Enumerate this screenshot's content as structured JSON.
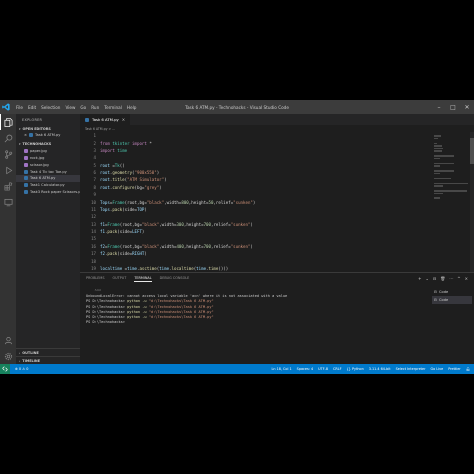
{
  "window": {
    "title": "Task 6 ATM.py - Technohacks - Visual Studio Code",
    "menu": [
      "File",
      "Edit",
      "Selection",
      "View",
      "Go",
      "Run",
      "Terminal",
      "Help"
    ]
  },
  "sidebar": {
    "title": "EXPLORER",
    "open_editors": {
      "label": "OPEN EDITORS",
      "items": [
        {
          "label": "Task 6 ATM.py",
          "close": "×"
        }
      ]
    },
    "workspace": {
      "label": "TECHNOHACKS",
      "files": [
        {
          "name": "paper.jpg",
          "color": "#a074c4"
        },
        {
          "name": "rock.jpg",
          "color": "#a074c4"
        },
        {
          "name": "scissor.jpg",
          "color": "#a074c4"
        },
        {
          "name": "Task 4 Tic tac Toe.py",
          "color": "#3572a5"
        },
        {
          "name": "Task 6 ATM.py",
          "color": "#3572a5"
        },
        {
          "name": "Task1 Calculator.py",
          "color": "#3572a5"
        },
        {
          "name": "Task3 Rock paper Scissors.py",
          "color": "#3572a5"
        }
      ]
    },
    "bottom_sections": [
      "OUTLINE",
      "TIMELINE"
    ]
  },
  "editor": {
    "tab_label": "Task 6 ATM.py",
    "tab_close": "×",
    "breadcrumb": "Task 6 ATM.py > ...",
    "lines": [
      {
        "n": "1",
        "tokens": []
      },
      {
        "n": "2",
        "tokens": [
          {
            "c": "kw",
            "t": "from "
          },
          {
            "c": "cl",
            "t": "tkinter "
          },
          {
            "c": "kw",
            "t": "import "
          },
          {
            "c": "pl",
            "t": "*"
          }
        ]
      },
      {
        "n": "3",
        "tokens": [
          {
            "c": "kw",
            "t": "import "
          },
          {
            "c": "cl",
            "t": "time"
          }
        ]
      },
      {
        "n": "4",
        "tokens": []
      },
      {
        "n": "5",
        "tokens": [
          {
            "c": "vr",
            "t": "root"
          },
          {
            "c": "pl",
            "t": " ="
          },
          {
            "c": "cl",
            "t": "Tk"
          },
          {
            "c": "pl",
            "t": "()"
          }
        ]
      },
      {
        "n": "6",
        "tokens": [
          {
            "c": "vr",
            "t": "root"
          },
          {
            "c": "pl",
            "t": "."
          },
          {
            "c": "fn",
            "t": "geometry"
          },
          {
            "c": "pl",
            "t": "("
          },
          {
            "c": "st",
            "t": "\"900x550\""
          },
          {
            "c": "pl",
            "t": ")"
          }
        ]
      },
      {
        "n": "7",
        "tokens": [
          {
            "c": "vr",
            "t": "root"
          },
          {
            "c": "pl",
            "t": "."
          },
          {
            "c": "fn",
            "t": "title"
          },
          {
            "c": "pl",
            "t": "("
          },
          {
            "c": "st",
            "t": "\"ATM Simulator\""
          },
          {
            "c": "pl",
            "t": ")"
          }
        ]
      },
      {
        "n": "8",
        "tokens": [
          {
            "c": "vr",
            "t": "root"
          },
          {
            "c": "pl",
            "t": "."
          },
          {
            "c": "fn",
            "t": "configure"
          },
          {
            "c": "pl",
            "t": "(bg="
          },
          {
            "c": "st",
            "t": "\"grey\""
          },
          {
            "c": "pl",
            "t": ")"
          }
        ]
      },
      {
        "n": "9",
        "tokens": []
      },
      {
        "n": "10",
        "tokens": [
          {
            "c": "vr",
            "t": "Tops"
          },
          {
            "c": "pl",
            "t": "="
          },
          {
            "c": "cl",
            "t": "Frame"
          },
          {
            "c": "pl",
            "t": "(root,bg="
          },
          {
            "c": "st",
            "t": "\"black\""
          },
          {
            "c": "pl",
            "t": ",width="
          },
          {
            "c": "nm",
            "t": "800"
          },
          {
            "c": "pl",
            "t": ",height="
          },
          {
            "c": "nm",
            "t": "50"
          },
          {
            "c": "pl",
            "t": ",relief="
          },
          {
            "c": "st",
            "t": "\"sunken\""
          },
          {
            "c": "pl",
            "t": ")"
          }
        ]
      },
      {
        "n": "11",
        "tokens": [
          {
            "c": "vr",
            "t": "Tops"
          },
          {
            "c": "pl",
            "t": "."
          },
          {
            "c": "fn",
            "t": "pack"
          },
          {
            "c": "pl",
            "t": "(side="
          },
          {
            "c": "vr",
            "t": "TOP"
          },
          {
            "c": "pl",
            "t": ")"
          }
        ]
      },
      {
        "n": "12",
        "tokens": []
      },
      {
        "n": "13",
        "tokens": [
          {
            "c": "vr",
            "t": "f1"
          },
          {
            "c": "pl",
            "t": "="
          },
          {
            "c": "cl",
            "t": "Frame"
          },
          {
            "c": "pl",
            "t": "(root,bg="
          },
          {
            "c": "st",
            "t": "\"black\""
          },
          {
            "c": "pl",
            "t": ",width="
          },
          {
            "c": "nm",
            "t": "300"
          },
          {
            "c": "pl",
            "t": ",height="
          },
          {
            "c": "nm",
            "t": "700"
          },
          {
            "c": "pl",
            "t": ",relief="
          },
          {
            "c": "st",
            "t": "\"sunken\""
          },
          {
            "c": "pl",
            "t": ")"
          }
        ]
      },
      {
        "n": "14",
        "tokens": [
          {
            "c": "vr",
            "t": "f1"
          },
          {
            "c": "pl",
            "t": "."
          },
          {
            "c": "fn",
            "t": "pack"
          },
          {
            "c": "pl",
            "t": "(side="
          },
          {
            "c": "vr",
            "t": "LEFT"
          },
          {
            "c": "pl",
            "t": ")"
          }
        ]
      },
      {
        "n": "15",
        "tokens": []
      },
      {
        "n": "16",
        "tokens": [
          {
            "c": "vr",
            "t": "f2"
          },
          {
            "c": "pl",
            "t": "="
          },
          {
            "c": "cl",
            "t": "Frame"
          },
          {
            "c": "pl",
            "t": "(root,bg="
          },
          {
            "c": "st",
            "t": "\"black\""
          },
          {
            "c": "pl",
            "t": ",width="
          },
          {
            "c": "nm",
            "t": "400"
          },
          {
            "c": "pl",
            "t": ",height="
          },
          {
            "c": "nm",
            "t": "700"
          },
          {
            "c": "pl",
            "t": ",relief="
          },
          {
            "c": "st",
            "t": "\"sunken\""
          },
          {
            "c": "pl",
            "t": ")"
          }
        ]
      },
      {
        "n": "17",
        "tokens": [
          {
            "c": "vr",
            "t": "f2"
          },
          {
            "c": "pl",
            "t": "."
          },
          {
            "c": "fn",
            "t": "pack"
          },
          {
            "c": "pl",
            "t": "(side="
          },
          {
            "c": "vr",
            "t": "RIGHT"
          },
          {
            "c": "pl",
            "t": ")"
          }
        ]
      },
      {
        "n": "18",
        "tokens": []
      },
      {
        "n": "19",
        "tokens": [
          {
            "c": "vr",
            "t": "localtime"
          },
          {
            "c": "pl",
            "t": " ="
          },
          {
            "c": "vr",
            "t": "time"
          },
          {
            "c": "pl",
            "t": "."
          },
          {
            "c": "fn",
            "t": "asctime"
          },
          {
            "c": "pl",
            "t": "("
          },
          {
            "c": "vr",
            "t": "time"
          },
          {
            "c": "pl",
            "t": "."
          },
          {
            "c": "fn",
            "t": "localtime"
          },
          {
            "c": "pl",
            "t": "("
          },
          {
            "c": "vr",
            "t": "time"
          },
          {
            "c": "pl",
            "t": "."
          },
          {
            "c": "fn",
            "t": "time"
          },
          {
            "c": "pl",
            "t": "()))"
          }
        ]
      },
      {
        "n": "20",
        "tokens": []
      },
      {
        "n": "21",
        "tokens": [
          {
            "c": "vr",
            "t": "label1"
          },
          {
            "c": "pl",
            "t": " ="
          },
          {
            "c": "cl",
            "t": "Label"
          },
          {
            "c": "pl",
            "t": "(Tops,font=("
          },
          {
            "c": "st",
            "t": "\"Times New Roman\""
          },
          {
            "c": "pl",
            "t": ","
          },
          {
            "c": "nm",
            "t": "26"
          },
          {
            "c": "pl",
            "t": ","
          },
          {
            "c": "st",
            "t": "'bold'"
          },
          {
            "c": "pl",
            "t": ") ,text="
          },
          {
            "c": "st",
            "t": "\"ATM Simulator\""
          },
          {
            "c": "pl",
            "t": ", fg="
          },
          {
            "c": "st",
            "t": "\"powder blue\""
          },
          {
            "c": "pl",
            "t": ",bg="
          },
          {
            "c": "st",
            "t": "\"grey\""
          },
          {
            "c": "pl",
            "t": ",bd="
          },
          {
            "c": "nm",
            "t": "10"
          },
          {
            "c": "pl",
            "t": ")"
          }
        ]
      },
      {
        "n": "22",
        "tokens": [
          {
            "c": "vr",
            "t": "label1"
          },
          {
            "c": "pl",
            "t": "."
          },
          {
            "c": "fn",
            "t": "grid"
          },
          {
            "c": "pl",
            "t": "(row="
          },
          {
            "c": "nm",
            "t": "0"
          },
          {
            "c": "pl",
            "t": ",column="
          },
          {
            "c": "nm",
            "t": "0"
          },
          {
            "c": "pl",
            "t": ")"
          }
        ]
      },
      {
        "n": "23",
        "tokens": []
      },
      {
        "n": "24",
        "tokens": [
          {
            "c": "vr",
            "t": "label1"
          },
          {
            "c": "pl",
            "t": "="
          },
          {
            "c": "cl",
            "t": "Label"
          },
          {
            "c": "pl",
            "t": "(Tops,font=("
          },
          {
            "c": "st",
            "t": "\"Times New Roman\""
          },
          {
            "c": "pl",
            "t": ","
          },
          {
            "c": "nm",
            "t": "20"
          },
          {
            "c": "pl",
            "t": ","
          },
          {
            "c": "st",
            "t": "'bold'"
          },
          {
            "c": "pl",
            "t": "), text=localtime,fg="
          },
          {
            "c": "st",
            "t": "\"powder blue\""
          },
          {
            "c": "pl",
            "t": ",bg="
          },
          {
            "c": "st",
            "t": "\"grey\""
          },
          {
            "c": "pl",
            "t": ",bd="
          },
          {
            "c": "nm",
            "t": "10"
          },
          {
            "c": "pl",
            "t": ")"
          }
        ]
      },
      {
        "n": "25",
        "tokens": [
          {
            "c": "vr",
            "t": "label1"
          },
          {
            "c": "pl",
            "t": "."
          },
          {
            "c": "fn",
            "t": "grid"
          },
          {
            "c": "pl",
            "t": "(row="
          },
          {
            "c": "nm",
            "t": "1"
          },
          {
            "c": "pl",
            "t": ",column="
          },
          {
            "c": "nm",
            "t": "0"
          },
          {
            "c": "pl",
            "t": ")"
          }
        ]
      },
      {
        "n": "26",
        "tokens": []
      },
      {
        "n": "27",
        "tokens": [
          {
            "c": "vr",
            "t": "number"
          },
          {
            "c": "pl",
            "t": " = "
          },
          {
            "c": "cl",
            "t": "StringVar"
          },
          {
            "c": "pl",
            "t": "()"
          }
        ]
      }
    ]
  },
  "panel": {
    "tabs": [
      "PROBLEMS",
      "OUTPUT",
      "TERMINAL",
      "DEBUG CONSOLE"
    ],
    "active_tab": "TERMINAL",
    "actions": [
      "+",
      "⌄",
      "⊟",
      "🗑",
      "⋯",
      "^",
      "×"
    ],
    "terminal_lines": [
      {
        "type": "plain",
        "text": "    ^^^"
      },
      {
        "type": "plain",
        "text": "UnboundLocalError: cannot access local variable 'acn' where it is not associated with a value"
      },
      {
        "type": "cmd",
        "prompt": "PS D:\\Technohacks> ",
        "cmd": "python -u ",
        "arg": "\"d:\\Technohacks\\Task 6 ATM.py\""
      },
      {
        "type": "cmd",
        "prompt": "PS D:\\Technohacks> ",
        "cmd": "python -u ",
        "arg": "\"d:\\Technohacks\\Task 6 ATM.py\""
      },
      {
        "type": "cmd",
        "prompt": "PS D:\\Technohacks> ",
        "cmd": "python -u ",
        "arg": "\"d:\\Technohacks\\Task 6 ATM.py\""
      },
      {
        "type": "cmd",
        "prompt": "PS D:\\Technohacks> ",
        "cmd": "python -u ",
        "arg": "\"d:\\Technohacks\\Task 6 ATM.py\""
      },
      {
        "type": "plain",
        "text": "PS D:\\Technohacks> "
      }
    ],
    "terminals": [
      "Code",
      "Code"
    ]
  },
  "statusbar": {
    "left": [
      "⊗ 0 ⚠ 0"
    ],
    "right": [
      "Ln 18, Col 1",
      "Spaces: 4",
      "UTF-8",
      "CRLF",
      "{} Python",
      "3.11.4 64-bit",
      "Select Interpreter",
      "Go Live",
      "Prettier"
    ]
  },
  "colors": {
    "accent": "#007acc",
    "editor_bg": "#1e1e1e",
    "sidebar_bg": "#252526",
    "activity_bg": "#333333"
  }
}
